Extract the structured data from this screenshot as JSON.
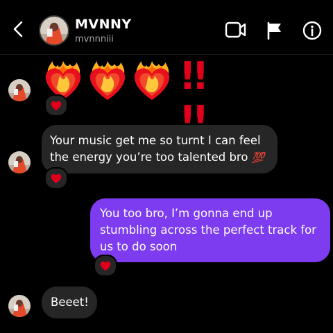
{
  "header": {
    "name": "MVNNY",
    "handle": "mvnnniii",
    "icons": [
      "back-chevron-icon",
      "video-camera-icon",
      "flag-icon",
      "info-icon"
    ]
  },
  "messages": [
    {
      "direction": "incoming",
      "emojis": [
        "heart-on-fire",
        "heart-on-fire",
        "heart-on-fire"
      ],
      "text": "!! !!",
      "reaction": "red-heart"
    },
    {
      "direction": "incoming",
      "line1": "Your music get me so turnt I can feel",
      "line2": "the energy you’re too talented bro",
      "emoji": "💯",
      "reaction": "red-heart"
    },
    {
      "direction": "outgoing",
      "line1": "You too bro, I’m gonna end up",
      "line2": "stumbling across the perfect track for",
      "line3": "us to do soon",
      "reaction": "red-heart"
    },
    {
      "direction": "incoming",
      "text": "Beeet!"
    }
  ],
  "colors": {
    "outgoing_bubble": "#7d3cf0",
    "incoming_bubble": "#262626",
    "background": "#000000",
    "heart": "#e0001b"
  }
}
